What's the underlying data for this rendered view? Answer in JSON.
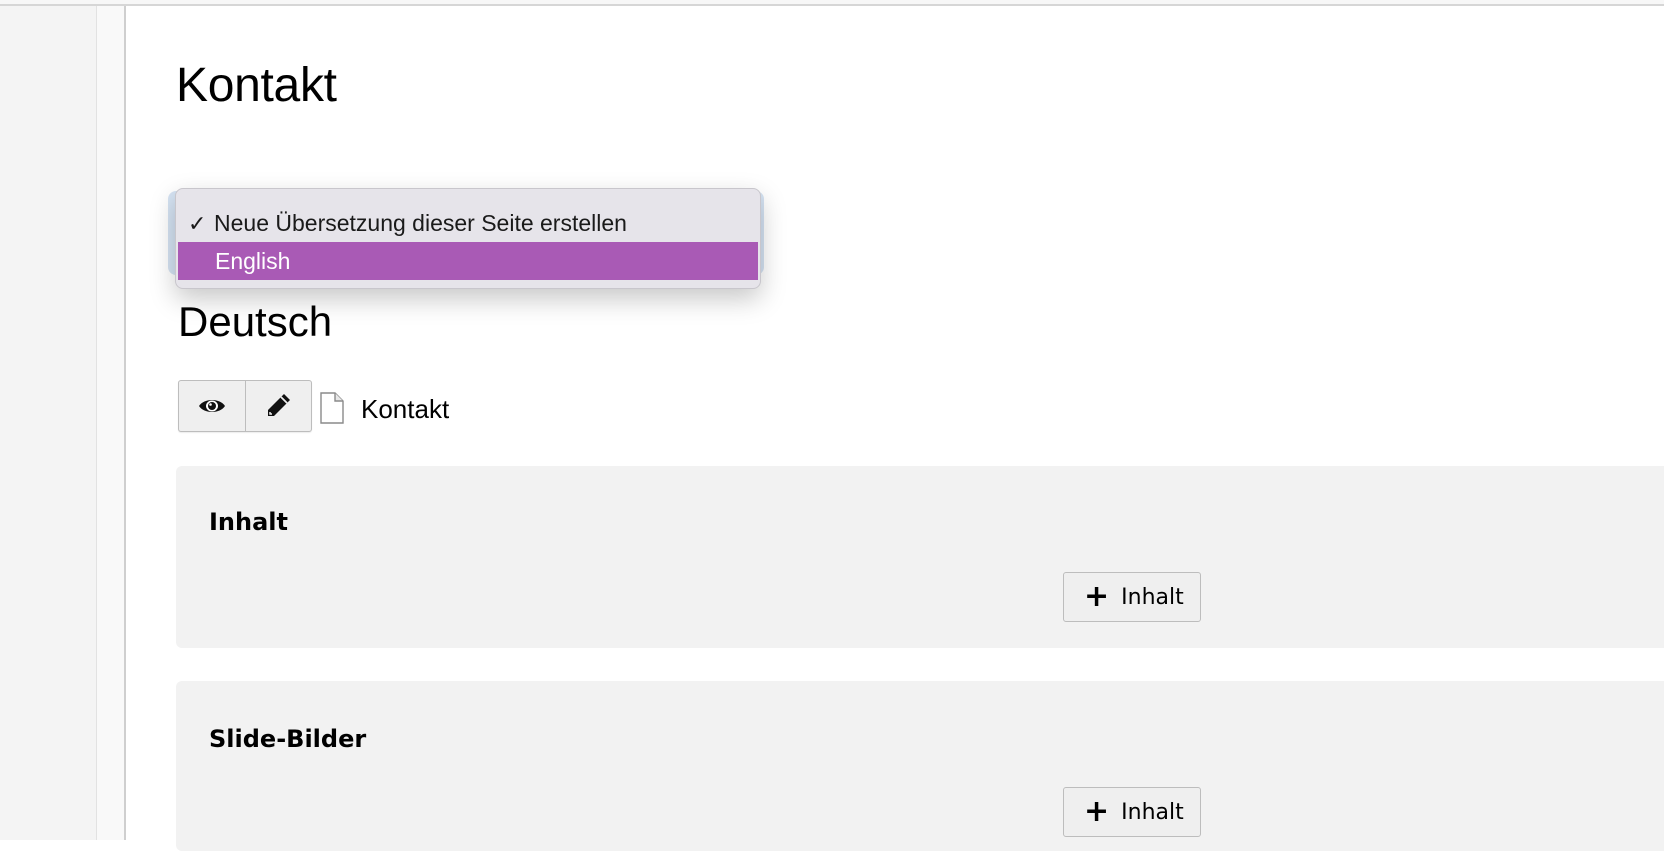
{
  "page": {
    "title": "Kontakt"
  },
  "language_select": {
    "options": [
      {
        "label": "Neue Übersetzung dieser Seite erstellen",
        "checked": true
      },
      {
        "label": "English",
        "highlighted": true
      }
    ],
    "check_mark": "✓"
  },
  "language_section": {
    "heading": "Deutsch",
    "page_name": "Kontakt",
    "view_icon": "eye-icon",
    "edit_icon": "pencil-icon",
    "page_icon": "document-icon"
  },
  "content_areas": [
    {
      "title": "Inhalt",
      "add_button_label": "Inhalt",
      "add_icon": "plus-icon"
    },
    {
      "title": "Slide-Bilder",
      "add_button_label": "Inhalt",
      "add_icon": "plus-icon"
    }
  ],
  "colors": {
    "highlight": "#a95ab5",
    "panel_bg": "#f2f2f2",
    "focus_ring": "#d5e3f3"
  }
}
